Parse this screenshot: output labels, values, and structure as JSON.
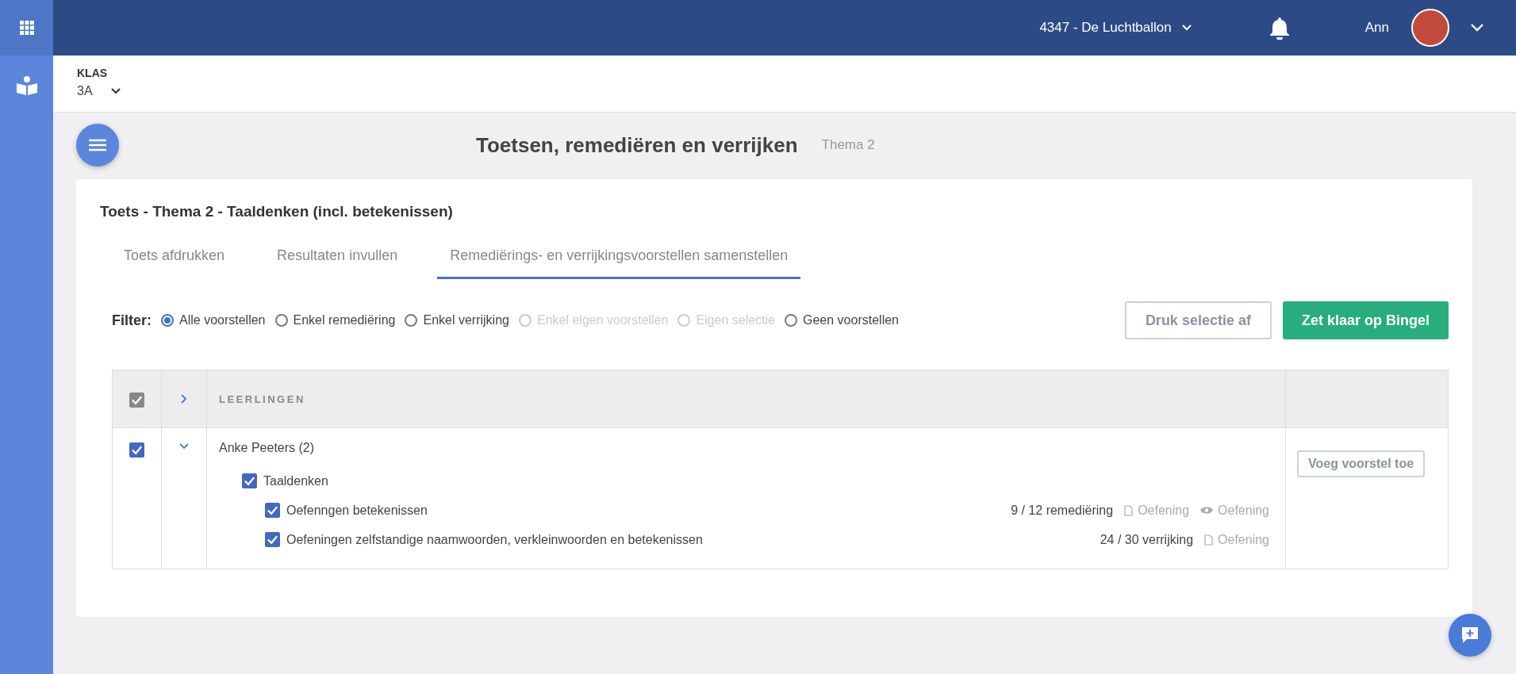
{
  "topbar": {
    "school": "4347 - De Luchtballon",
    "user": "Ann"
  },
  "class_selector": {
    "label": "KLAS",
    "value": "3A"
  },
  "page": {
    "title": "Toetsen, remediëren en verrijken",
    "subtitle": "Thema 2"
  },
  "card": {
    "title": "Toets - Thema 2 - Taaldenken (incl. betekenissen)",
    "tabs": [
      {
        "label": "Toets afdrukken",
        "selected": false
      },
      {
        "label": "Resultaten invullen",
        "selected": false
      },
      {
        "label": "Remediërings- en verrijkingsvoorstellen samenstellen",
        "selected": true
      }
    ],
    "filter": {
      "label": "Filter:",
      "options": [
        {
          "label": "Alle voorstellen",
          "selected": true,
          "disabled": false
        },
        {
          "label": "Enkel remediëring",
          "selected": false,
          "disabled": false
        },
        {
          "label": "Enkel verrijking",
          "selected": false,
          "disabled": false
        },
        {
          "label": "Enkel eigen voorstellen",
          "selected": false,
          "disabled": true
        },
        {
          "label": "Eigen selectie",
          "selected": false,
          "disabled": true
        },
        {
          "label": "Geen voorstellen",
          "selected": false,
          "disabled": false
        }
      ]
    },
    "buttons": [
      {
        "label": "Druk selectie af",
        "kind": "outline"
      },
      {
        "label": "Zet klaar op Bingel",
        "kind": "primary"
      }
    ],
    "table": {
      "header": {
        "checked": true,
        "expanded": false,
        "column": "LEERLINGEN"
      },
      "rows": [
        {
          "name": "Anke Peeters (2)",
          "checked": true,
          "expanded": true,
          "action": "Voeg voorstel toe",
          "children": [
            {
              "name": "Taaldenken",
              "checked": true,
              "children": [
                {
                  "name": "Oefenngen betekenissen",
                  "checked": true,
                  "score": "9 / 12 remediëring",
                  "links": [
                    {
                      "kind": "file",
                      "label": "Oefening"
                    },
                    {
                      "kind": "preview",
                      "label": "Oefening"
                    }
                  ]
                },
                {
                  "name": "Oefeningen zelfstandige naamwoorden, verkleinwoorden en betekenissen",
                  "checked": true,
                  "score": "24 / 30 verrijking",
                  "links": [
                    {
                      "kind": "file",
                      "label": "Oefening"
                    }
                  ]
                }
              ]
            }
          ]
        }
      ]
    }
  }
}
